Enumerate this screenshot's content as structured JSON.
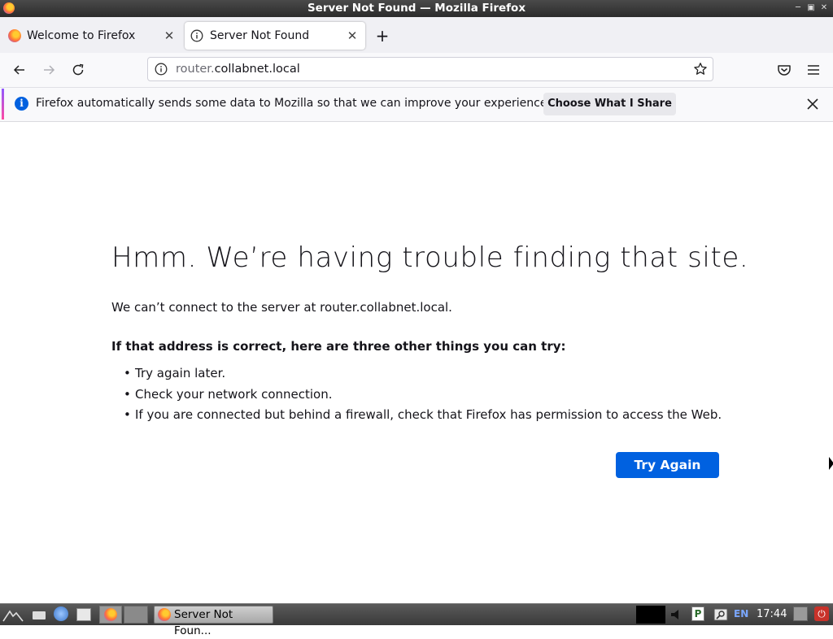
{
  "window": {
    "title": "Server Not Found — Mozilla Firefox"
  },
  "tabs": [
    {
      "label": "Welcome to Firefox",
      "icon": "firefox-icon",
      "active": false
    },
    {
      "label": "Server Not Found",
      "icon": "info-icon",
      "active": true
    }
  ],
  "urlbar": {
    "prefix": "router.",
    "domain": "collabnet.local"
  },
  "notification": {
    "message": "Firefox automatically sends some data to Mozilla so that we can improve your experience.",
    "button_label": "Choose What I Share"
  },
  "error_page": {
    "title": "Hmm. We’re having trouble finding that site.",
    "description": "We can’t connect to the server at router.collabnet.local.",
    "subheading": "If that address is correct, here are three other things you can try:",
    "suggestions": [
      "Try again later.",
      "Check your network connection.",
      "If you are connected but behind a firewall, check that Firefox has permission to access the Web."
    ],
    "try_again_label": "Try Again"
  },
  "taskbar": {
    "task_label": "Server Not Foun...",
    "language": "EN",
    "clock": "17:44"
  },
  "colors": {
    "accent_blue": "#0061e0",
    "info_blue": "#0060df"
  }
}
